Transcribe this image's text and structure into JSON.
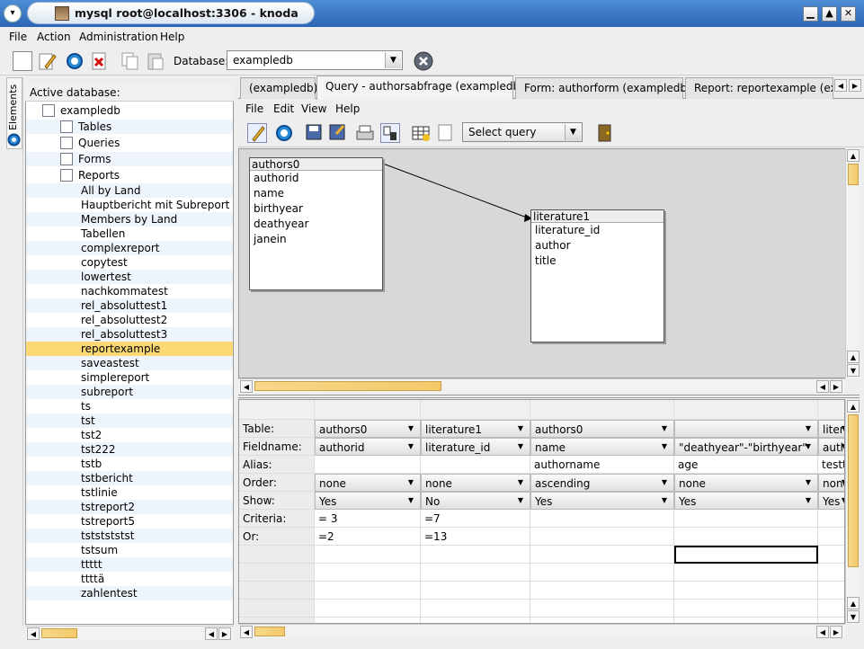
{
  "window": {
    "title": "mysql root@localhost:3306 - knoda"
  },
  "menubar": [
    {
      "label": "File"
    },
    {
      "label": "Action"
    },
    {
      "label": "Administration"
    },
    {
      "label": "Help"
    }
  ],
  "toolbar": {
    "database_label": "Database:",
    "database_value": "exampledb"
  },
  "sidebar": {
    "tab_label": "Elements",
    "active_db_label": "Active database:"
  },
  "tree": {
    "root": "exampledb",
    "groups": [
      "Tables",
      "Queries",
      "Forms",
      "Reports"
    ],
    "reports": [
      "All by Land",
      "Hauptbericht mit Subreport",
      "Members by Land",
      "Tabellen",
      "complexreport",
      "copytest",
      "lowertest",
      "nachkommatest",
      "rel_absoluttest1",
      "rel_absoluttest2",
      "rel_absoluttest3",
      "reportexample",
      "saveastest",
      "simplereport",
      "subreport",
      "ts",
      "tst",
      "tst2",
      "tst222",
      "tstb",
      "tstbericht",
      "tstlinie",
      "tstreport2",
      "tstreport5",
      "tststststst",
      "tstsum",
      "ttttt",
      "ttttä",
      "zahlentest"
    ],
    "selected": "reportexample"
  },
  "tabs": [
    {
      "label": "(exampledb)"
    },
    {
      "label": "Query - authorsabfrage (exampledb)"
    },
    {
      "label": "Form: authorform (exampledb)"
    },
    {
      "label": "Report: reportexample (exam"
    }
  ],
  "inner_menu": [
    {
      "label": "File"
    },
    {
      "label": "Edit"
    },
    {
      "label": "View"
    },
    {
      "label": "Help"
    }
  ],
  "inner_toolbar": {
    "select_query": "Select query"
  },
  "tables": [
    {
      "name": "authors0",
      "fields": [
        "authorid",
        "name",
        "birthyear",
        "deathyear",
        "janein"
      ]
    },
    {
      "name": "literature1",
      "fields": [
        "literature_id",
        "author",
        "title"
      ]
    }
  ],
  "grid": {
    "row_labels": [
      "Table:",
      "Fieldname:",
      "Alias:",
      "Order:",
      "Show:",
      "Criteria:",
      "Or:"
    ],
    "columns": [
      {
        "table": "authors0",
        "field": "authorid",
        "alias": "",
        "order": "none",
        "show": "Yes",
        "criteria": "= 3",
        "or": "=2"
      },
      {
        "table": "literature1",
        "field": "literature_id",
        "alias": "",
        "order": "none",
        "show": "No",
        "criteria": "=7",
        "or": "=13"
      },
      {
        "table": "authors0",
        "field": "name",
        "alias": "authorname",
        "order": "ascending",
        "show": "Yes",
        "criteria": "",
        "or": ""
      },
      {
        "table": "",
        "field": "\"deathyear\"-\"birthyear\"",
        "alias": "age",
        "order": "none",
        "show": "Yes",
        "criteria": "",
        "or": ""
      },
      {
        "table": "litera",
        "field": "auth",
        "alias": "testte",
        "order": "none",
        "show": "Yes",
        "criteria": "",
        "or": ""
      }
    ]
  }
}
